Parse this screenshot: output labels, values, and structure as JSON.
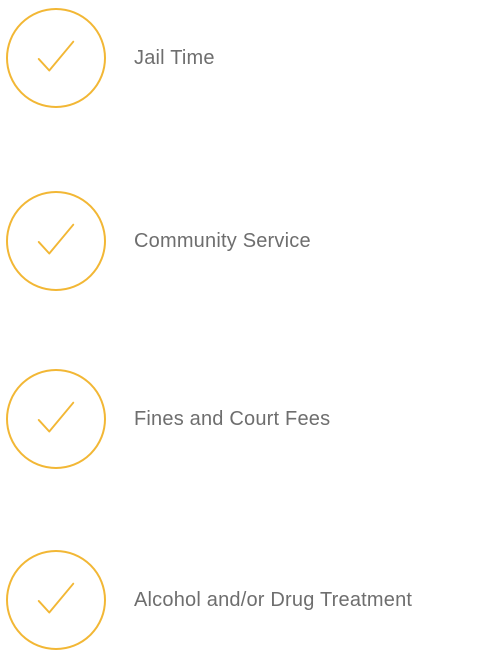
{
  "theme": {
    "accent": "#F2B735",
    "text": "#6e6e6e",
    "background": "#ffffff"
  },
  "items": [
    {
      "icon": "check-icon",
      "label": "Jail Time"
    },
    {
      "icon": "check-icon",
      "label": "Community Service"
    },
    {
      "icon": "check-icon",
      "label": "Fines and Court Fees"
    },
    {
      "icon": "check-icon",
      "label": "Alcohol and/or Drug Treatment"
    }
  ]
}
